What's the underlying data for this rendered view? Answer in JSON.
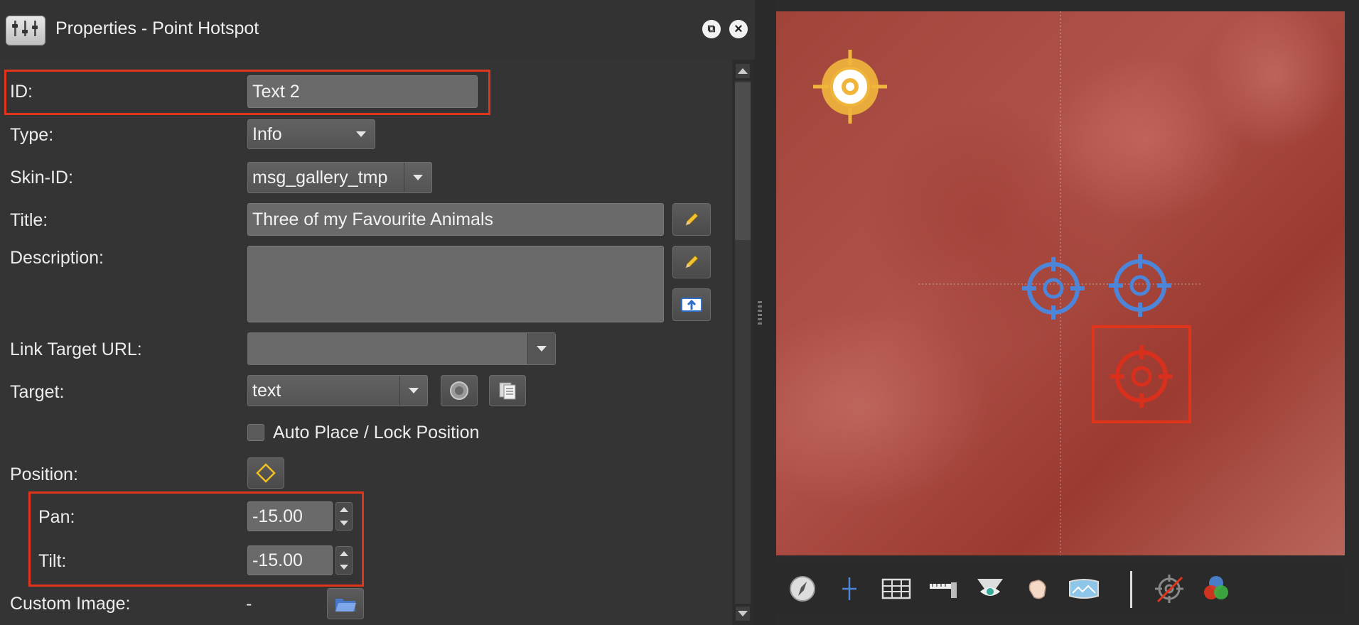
{
  "window": {
    "title": "Properties - Point Hotspot"
  },
  "form": {
    "id_label": "ID:",
    "id_value": "Text 2",
    "type_label": "Type:",
    "type_value": "Info",
    "skin_label": "Skin-ID:",
    "skin_value": "msg_gallery_tmp",
    "title_label": "Title:",
    "title_value": "Three of my Favourite Animals",
    "description_label": "Description:",
    "description_value": "",
    "link_label": "Link Target URL:",
    "link_value": "",
    "target_label": "Target:",
    "target_value": "text",
    "auto_place_label": "Auto Place / Lock Position",
    "auto_place_checked": false,
    "position_label": "Position:",
    "pan_label": "Pan:",
    "pan_value": "-15.00",
    "tilt_label": "Tilt:",
    "tilt_value": "-15.00",
    "custom_image_label": "Custom Image:",
    "custom_image_value": "-"
  },
  "colors": {
    "highlight": "#e0341c",
    "hotspot_yellow": "#f0b63c",
    "hotspot_blue": "#4d86d8",
    "hotspot_red": "#d8301c"
  },
  "viewer_toolbar": {
    "icons": [
      "compass-icon",
      "crosshair-line-icon",
      "grid-icon",
      "ruler-icon",
      "eye-icon",
      "hand-icon",
      "panorama-icon",
      "hotspot-hide-icon",
      "color-circles-icon"
    ]
  }
}
